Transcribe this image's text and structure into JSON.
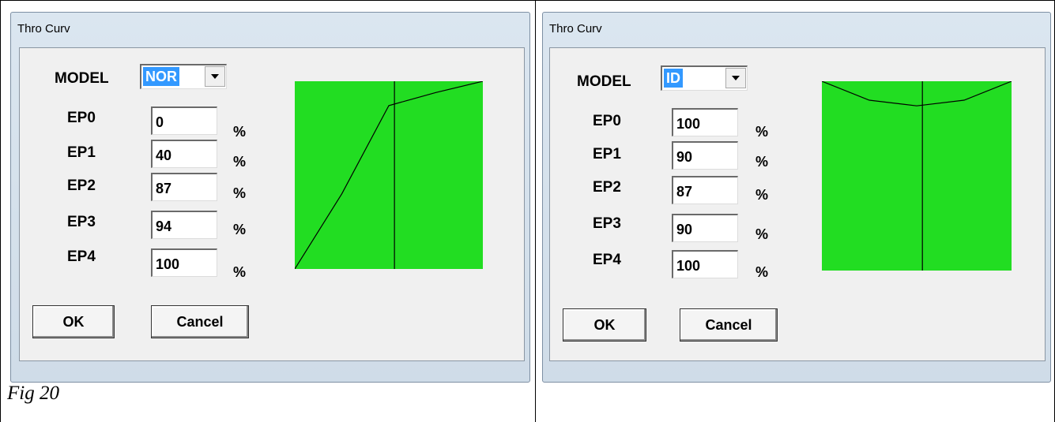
{
  "figure": {
    "caption": "Fig 20"
  },
  "dialogs": [
    {
      "title": "Thro Curv",
      "model_label": "MODEL",
      "model_value": "NOR",
      "percent_symbol": "%",
      "endpoints": [
        {
          "label": "EP0",
          "value": "0"
        },
        {
          "label": "EP1",
          "value": "40"
        },
        {
          "label": "EP2",
          "value": "87"
        },
        {
          "label": "EP3",
          "value": "94"
        },
        {
          "label": "EP4",
          "value": "100"
        }
      ],
      "ok_label": "OK",
      "cancel_label": "Cancel",
      "curve_values": [
        0,
        40,
        87,
        94,
        100
      ],
      "stick_position": 0.53
    },
    {
      "title": "Thro Curv",
      "model_label": "MODEL",
      "model_value": "ID",
      "percent_symbol": "%",
      "endpoints": [
        {
          "label": "EP0",
          "value": "100"
        },
        {
          "label": "EP1",
          "value": "90"
        },
        {
          "label": "EP2",
          "value": "87"
        },
        {
          "label": "EP3",
          "value": "90"
        },
        {
          "label": "EP4",
          "value": "100"
        }
      ],
      "ok_label": "OK",
      "cancel_label": "Cancel",
      "curve_values": [
        100,
        90,
        87,
        90,
        100
      ],
      "stick_position": 0.53
    }
  ],
  "colors": {
    "graph_background": "#22dd22",
    "selection_highlight": "#3399ff",
    "curve_line": "#000000"
  }
}
